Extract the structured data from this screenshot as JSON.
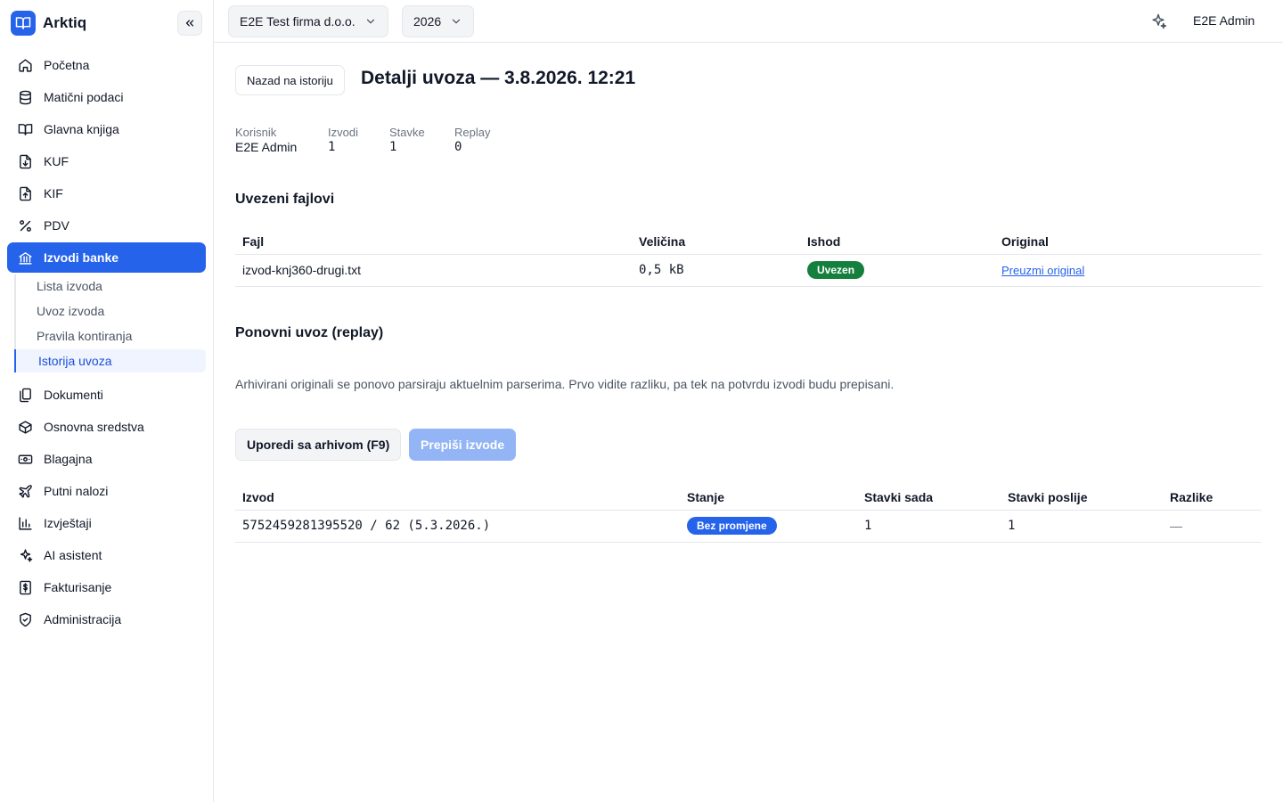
{
  "brand": {
    "name": "Arktiq"
  },
  "sidebar": {
    "items": [
      {
        "label": "Početna",
        "icon": "home-icon"
      },
      {
        "label": "Matični podaci",
        "icon": "database-icon"
      },
      {
        "label": "Glavna knjiga",
        "icon": "book-icon"
      },
      {
        "label": "KUF",
        "icon": "file-download-icon"
      },
      {
        "label": "KIF",
        "icon": "file-upload-icon"
      },
      {
        "label": "PDV",
        "icon": "percent-icon"
      },
      {
        "label": "Izvodi banke",
        "icon": "bank-icon",
        "active": true
      },
      {
        "label": "Dokumenti",
        "icon": "documents-icon"
      },
      {
        "label": "Osnovna sredstva",
        "icon": "box-icon"
      },
      {
        "label": "Blagajna",
        "icon": "cash-icon"
      },
      {
        "label": "Putni nalozi",
        "icon": "plane-icon"
      },
      {
        "label": "Izvještaji",
        "icon": "chart-icon"
      },
      {
        "label": "AI asistent",
        "icon": "sparkle-icon"
      },
      {
        "label": "Fakturisanje",
        "icon": "invoice-icon"
      },
      {
        "label": "Administracija",
        "icon": "shield-icon"
      }
    ],
    "subitems": [
      {
        "label": "Lista izvoda"
      },
      {
        "label": "Uvoz izvoda"
      },
      {
        "label": "Pravila kontiranja"
      },
      {
        "label": "Istorija uvoza",
        "active": true
      }
    ]
  },
  "topbar": {
    "company": "E2E Test firma d.o.o.",
    "year": "2026",
    "user": "E2E Admin"
  },
  "page": {
    "back_label": "Nazad na istoriju",
    "title": "Detalji uvoza — 3.8.2026. 12:21"
  },
  "meta": [
    {
      "label": "Korisnik",
      "value": "E2E Admin"
    },
    {
      "label": "Izvodi",
      "value": "1"
    },
    {
      "label": "Stavke",
      "value": "1"
    },
    {
      "label": "Replay",
      "value": "0"
    }
  ],
  "files": {
    "title": "Uvezeni fajlovi",
    "columns": [
      "Fajl",
      "Veličina",
      "Ishod",
      "Original"
    ],
    "rows": [
      {
        "file": "izvod-knj360-drugi.txt",
        "size": "0,5 kB",
        "status": "Uvezen",
        "action": "Preuzmi original"
      }
    ]
  },
  "replay": {
    "title": "Ponovni uvoz (replay)",
    "description": "Arhivirani originali se ponovo parsiraju aktuelnim parserima. Prvo vidite razliku, pa tek na potvrdu izvodi budu prepisani.",
    "compare_label": "Uporedi sa arhivom (F9)",
    "overwrite_label": "Prepiši izvode",
    "columns": [
      "Izvod",
      "Stanje",
      "Stavki sada",
      "Stavki poslije",
      "Razlike"
    ],
    "rows": [
      {
        "statement": "5752459281395520 / 62 (5.3.2026.)",
        "state": "Bez promjene",
        "now": "1",
        "after": "1",
        "diff": "—"
      }
    ]
  },
  "colors": {
    "accent": "#2563eb",
    "success": "#15803d",
    "disabled": "#93b4f5"
  }
}
